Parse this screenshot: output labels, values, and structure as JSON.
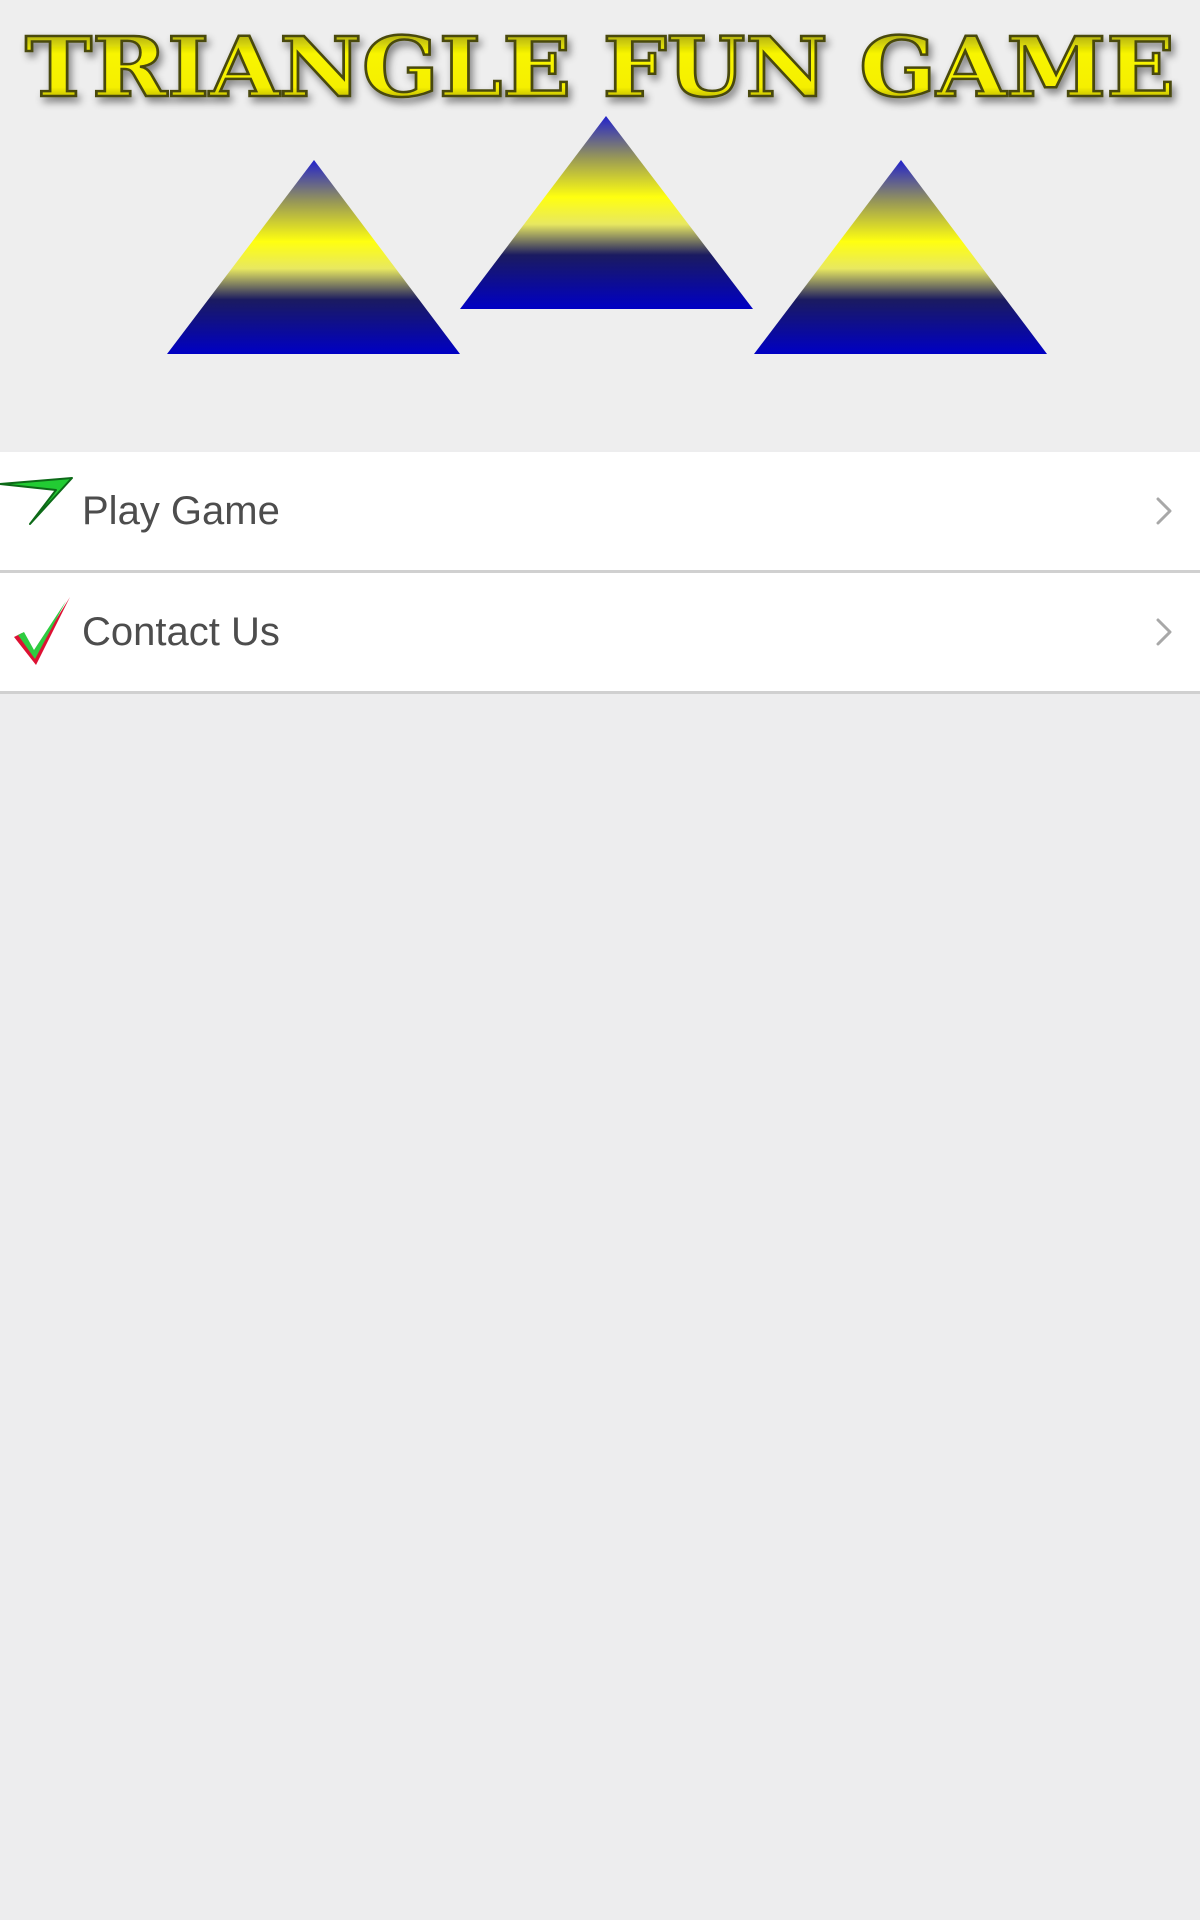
{
  "header": {
    "title": "TRIANGLE FUN GAME"
  },
  "menu": {
    "items": [
      {
        "label": "Play Game",
        "icon": "green-arrow-icon"
      },
      {
        "label": "Contact Us",
        "icon": "checkmark-icon"
      }
    ]
  },
  "colors": {
    "background": "#ededee",
    "row_background": "#ffffff",
    "label_text": "#4d4d4d",
    "title_yellow": "#f5f000",
    "triangle_blue": "#0000c0",
    "triangle_yellow": "#ffff00"
  }
}
